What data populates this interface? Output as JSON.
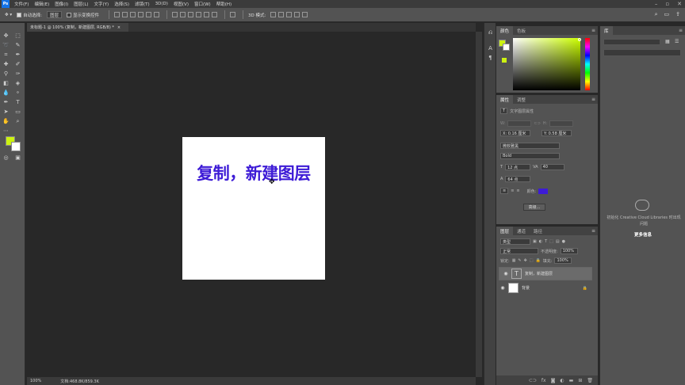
{
  "app": {
    "logo": "Ps"
  },
  "menu": [
    "文件(F)",
    "编辑(E)",
    "图像(I)",
    "图层(L)",
    "文字(Y)",
    "选择(S)",
    "滤镜(T)",
    "3D(D)",
    "视图(V)",
    "窗口(W)",
    "帮助(H)"
  ],
  "options": {
    "auto_select_label": "自动选择:",
    "auto_select_value": "图层",
    "show_transform_label": "显示变换控件",
    "mode_3d": "3D 模式:"
  },
  "document": {
    "tab_title": "未标题-1 @ 100% (复制，新建图层, RGB/8) *",
    "text": "复制，新建图层",
    "text_color": "#3d1bd6"
  },
  "status": {
    "zoom": "100%",
    "doc_size": "文档:468.8K/859.3K"
  },
  "color_panel": {
    "tabs": [
      "颜色",
      "色板"
    ],
    "foreground": "#ccf211",
    "background": "#ffffff"
  },
  "properties": {
    "tabs": [
      "属性",
      "调整"
    ],
    "title": "文字图层属性",
    "w_label": "W:",
    "h_label": "H:",
    "x_value": "X: 0.16 厘米",
    "y_value": "Y: 0.58 厘米",
    "font_family": "微软雅黑",
    "font_style": "Bold",
    "font_size": "12 点",
    "tracking": "40",
    "leading": "64 点",
    "color_label": "颜色:",
    "advanced_button": "高级..."
  },
  "layers": {
    "tabs": [
      "图层",
      "通道",
      "路径"
    ],
    "filter": "类型",
    "blend_mode": "正常",
    "opacity_label": "不透明度:",
    "opacity": "100%",
    "lock_label": "锁定:",
    "fill_label": "填充:",
    "fill": "100%",
    "items": [
      {
        "name": "复制，新建图层",
        "type": "text",
        "selected": true
      },
      {
        "name": "背景",
        "type": "background",
        "selected": false
      }
    ]
  },
  "libraries": {
    "tab": "库",
    "message": "初始化 Creative Cloud Libraries 时出现问题",
    "more_link": "更多信息"
  }
}
